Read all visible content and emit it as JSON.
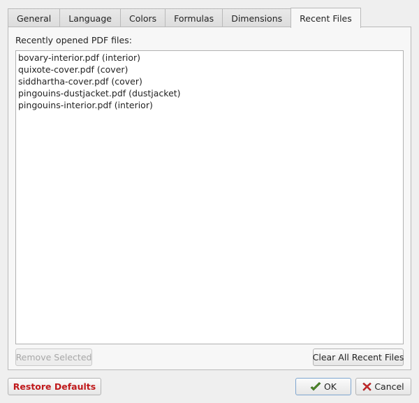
{
  "tabs": [
    {
      "label": "General",
      "active": false
    },
    {
      "label": "Language",
      "active": false
    },
    {
      "label": "Colors",
      "active": false
    },
    {
      "label": "Formulas",
      "active": false
    },
    {
      "label": "Dimensions",
      "active": false
    },
    {
      "label": "Recent Files",
      "active": true
    }
  ],
  "recent_files": {
    "label": "Recently opened PDF files:",
    "items": [
      "bovary-interior.pdf (interior)",
      "quixote-cover.pdf (cover)",
      "siddhartha-cover.pdf (cover)",
      "pingouins-dustjacket.pdf (dustjacket)",
      "pingouins-interior.pdf (interior)"
    ],
    "remove_selected_label": "Remove Selected",
    "clear_all_label": "Clear All Recent Files"
  },
  "footer": {
    "restore_defaults_label": "Restore Defaults",
    "ok_label": "OK",
    "cancel_label": "Cancel"
  },
  "icons": {
    "ok": "checkmark-icon",
    "cancel": "x-icon"
  },
  "colors": {
    "restore_defaults_text": "#c0191b",
    "ok_icon": "#4f8a2a",
    "cancel_icon": "#c8282a"
  }
}
